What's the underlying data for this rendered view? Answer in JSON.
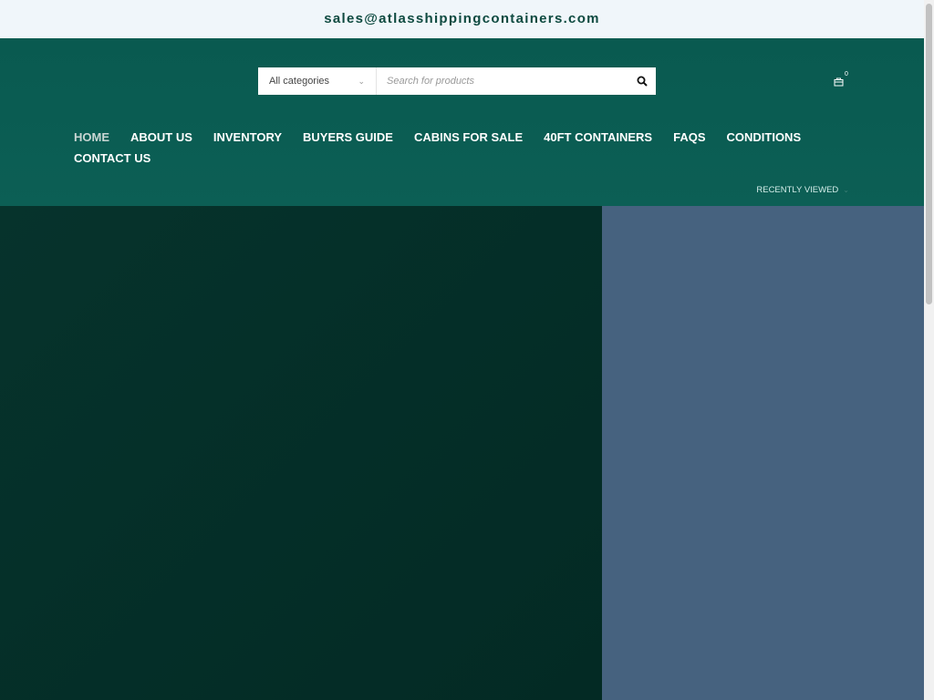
{
  "topbar": {
    "email": "sales@atlasshippingcontainers.com"
  },
  "search": {
    "category": "All categories",
    "placeholder": "Search for products"
  },
  "cart": {
    "count": "0"
  },
  "nav": {
    "items": [
      {
        "label": "HOME"
      },
      {
        "label": "ABOUT US"
      },
      {
        "label": "INVENTORY"
      },
      {
        "label": "BUYERS GUIDE"
      },
      {
        "label": "CABINS FOR SALE"
      },
      {
        "label": "40FT CONTAINERS"
      },
      {
        "label": "FAQS"
      },
      {
        "label": "CONDITIONS"
      },
      {
        "label": "CONTACT US"
      }
    ]
  },
  "recently_viewed": "RECENTLY VIEWED",
  "colors": {
    "header": "#095a50",
    "hero_left": "#04302a",
    "hero_right": "#46627f"
  }
}
